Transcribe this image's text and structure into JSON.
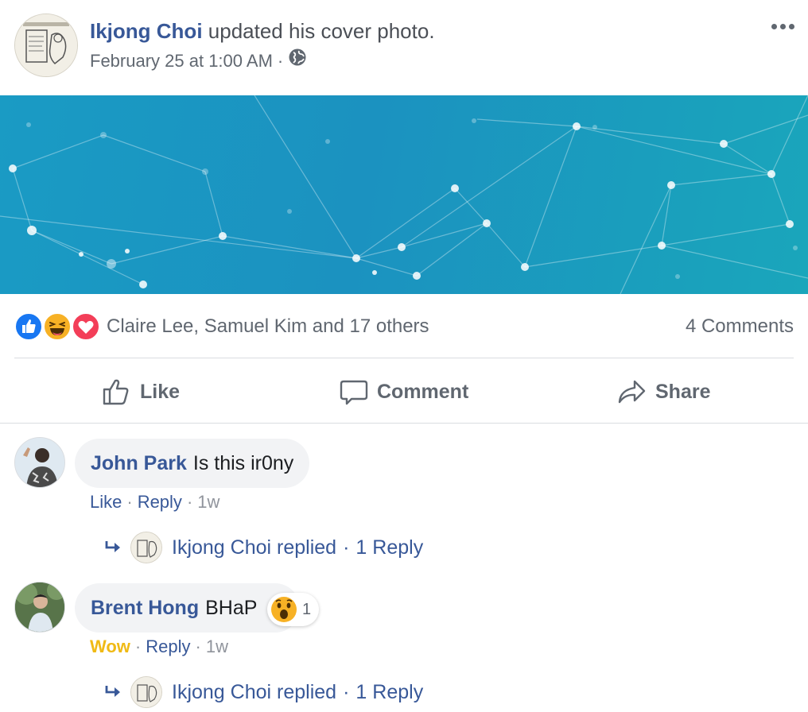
{
  "post": {
    "author": "Ikjong Choi",
    "action": "updated his cover photo.",
    "timestamp": "February 25 at 1:00 AM",
    "separator": "·",
    "privacy_icon": "globe-icon"
  },
  "reactions": {
    "icons": [
      "like-reaction-icon",
      "haha-reaction-icon",
      "love-reaction-icon"
    ],
    "summary": "Claire Lee, Samuel Kim and 17 others",
    "comments_count": "4 Comments"
  },
  "actions": {
    "like": "Like",
    "comment": "Comment",
    "share": "Share"
  },
  "comments": [
    {
      "author": "John Park",
      "text": "Is this ir0ny",
      "like_label": "Like",
      "reply_label": "Reply",
      "time": "1w",
      "replies": {
        "author": "Ikjong Choi",
        "verb": "replied",
        "count": "1 Reply"
      }
    },
    {
      "author": "Brent Hong",
      "text": "BHaP",
      "reaction_icon": "wow-reaction-icon",
      "reaction_count": "1",
      "like_label": "Wow",
      "reply_label": "Reply",
      "time": "1w",
      "replies": {
        "author": "Ikjong Choi",
        "verb": "replied",
        "count": "1 Reply"
      }
    }
  ],
  "colors": {
    "link": "#385898",
    "muted": "#606770",
    "cover": "#1a9bc4",
    "wow": "#f0ba15",
    "bubble": "#f2f3f5"
  }
}
